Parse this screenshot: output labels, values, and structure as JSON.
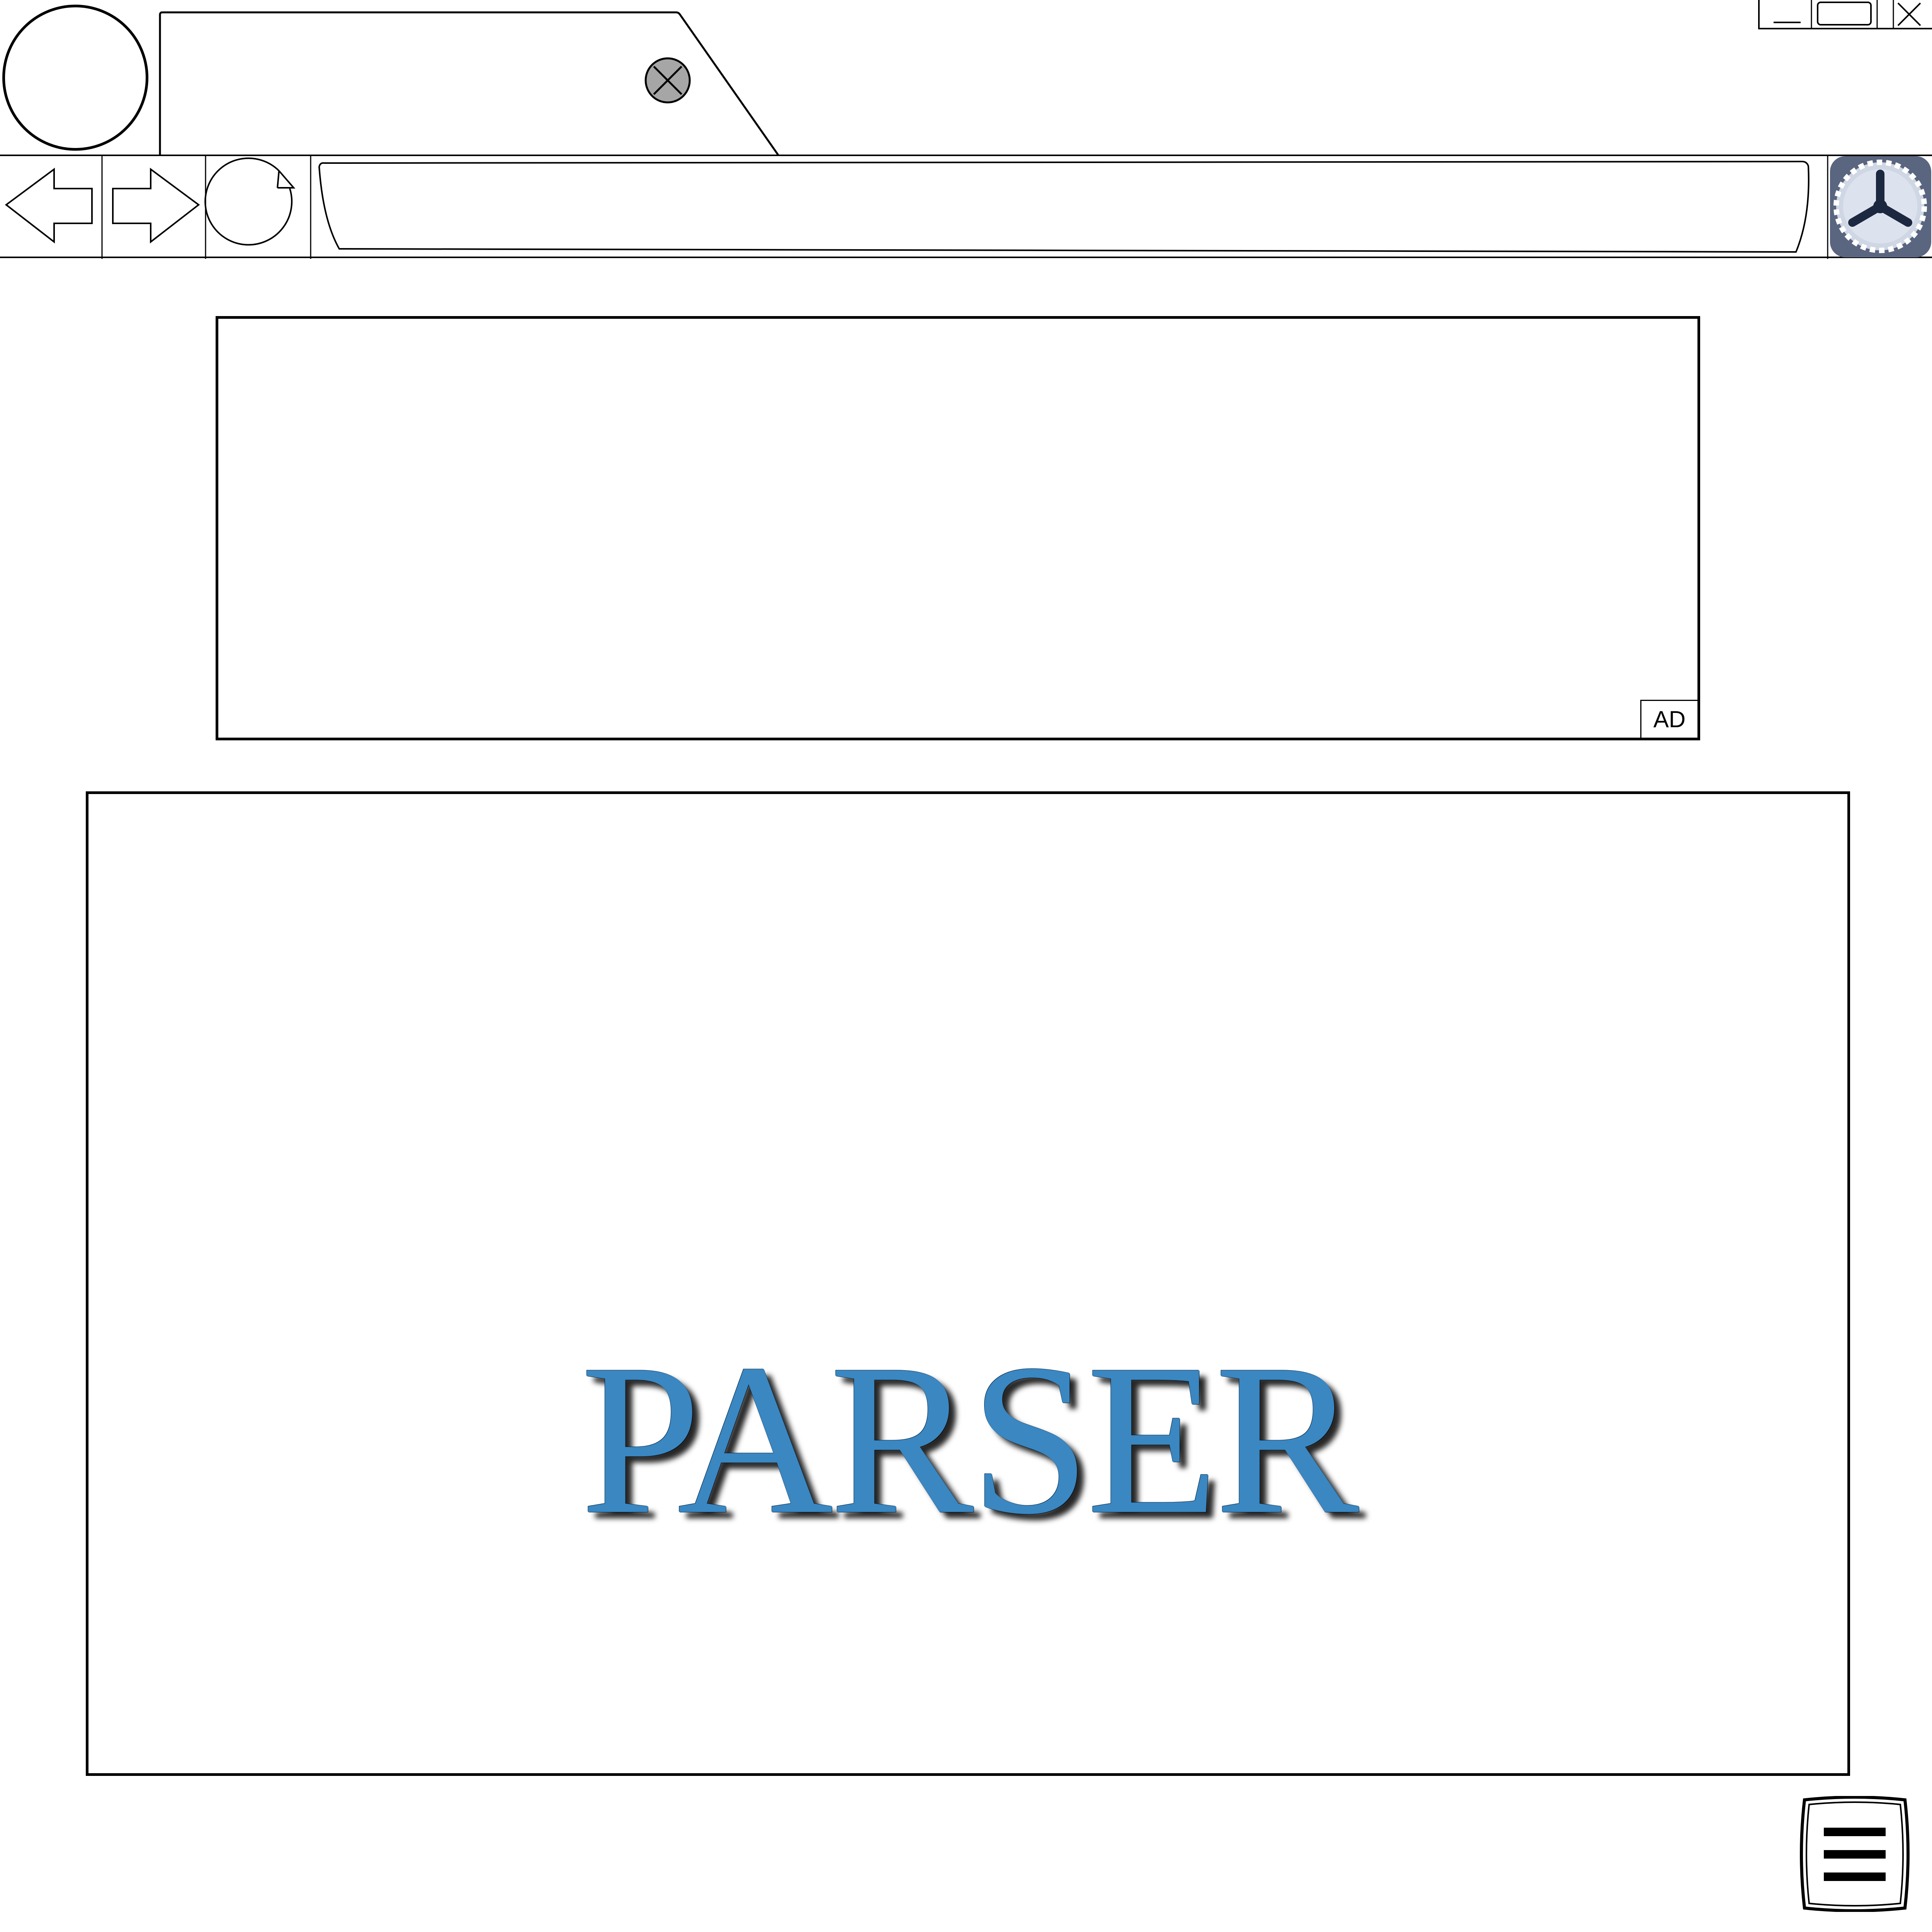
{
  "browser": {
    "tab": {
      "title": "",
      "close_icon": "close-circle-icon"
    },
    "window_controls": {
      "minimize_icon": "minimize-icon",
      "maximize_icon": "maximize-icon",
      "close_icon": "close-icon"
    },
    "nav": {
      "back_icon": "back-arrow-icon",
      "forward_icon": "forward-arrow-icon",
      "reload_icon": "reload-icon",
      "address_value": "",
      "settings_icon": "gear-icon"
    }
  },
  "ad": {
    "label": "AD"
  },
  "main": {
    "logo_text": "PARSER"
  },
  "menu": {
    "icon": "hamburger-menu-icon"
  },
  "colors": {
    "logo_blue": "#3a87c2",
    "close_badge_fill": "#a6a6a6",
    "gear_fill": "#5a6580"
  }
}
